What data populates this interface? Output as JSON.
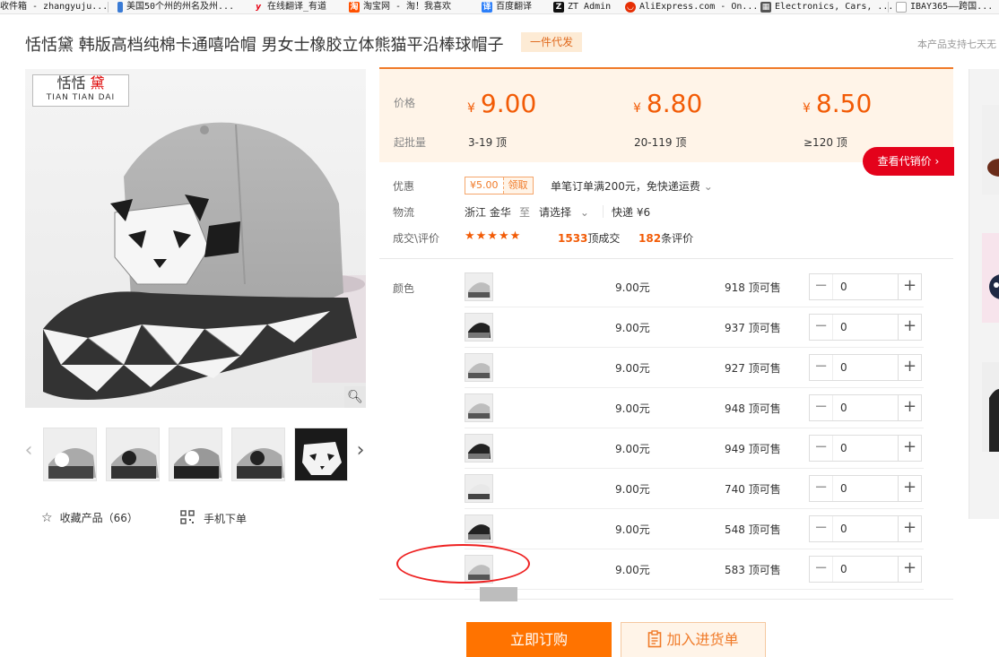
{
  "bookmarks": [
    {
      "label": "收件箱 - zhangyuju...",
      "icon": "mail-icon",
      "color": "#888888"
    },
    {
      "label": "美国50个州的州名及州...",
      "icon": "doc-icon",
      "color": "#3a7bd5"
    },
    {
      "label": "在线翻译_有道",
      "icon": "youdao-icon",
      "color": "#e60012"
    },
    {
      "label": "淘宝网 - 淘！我喜欢",
      "icon": "taobao-icon",
      "color": "#ff5000"
    },
    {
      "label": "百度翻译",
      "icon": "baidu-translate-icon",
      "color": "#2d7ff9"
    },
    {
      "label": "ZT Admin",
      "icon": "zt-icon",
      "color": "#222222"
    },
    {
      "label": "AliExpress.com - On...",
      "icon": "aliexpress-icon",
      "color": "#e62e04"
    },
    {
      "label": "Electronics, Cars, ...",
      "icon": "ebay-icon",
      "color": "#555555"
    },
    {
      "label": "IBAY365——跨国...",
      "icon": "page-icon",
      "color": "#999999"
    }
  ],
  "product": {
    "title": "恬恬黛 韩版高档纯棉卡通嘻哈帽 男女士橡胶立体熊猫平沿棒球帽子",
    "badge": "一件代发",
    "right_note": "本产品支持七天无",
    "logo_cn_1": "恬恬",
    "logo_cn_2": "黛",
    "logo_en": "TIAN TIAN DAI"
  },
  "gallery": {
    "favorite_label": "收藏产品（66）",
    "mobile_label": "手机下单"
  },
  "pricing": {
    "price_label": "价格",
    "moq_label": "起批量",
    "currency": "¥",
    "tiers": [
      {
        "price": "9.00",
        "range": "3-19 顶"
      },
      {
        "price": "8.80",
        "range": "20-119 顶"
      },
      {
        "price": "8.50",
        "range": "≥120 顶"
      }
    ],
    "agent_button": "查看代销价"
  },
  "info": {
    "discount_label": "优惠",
    "coupon_value": "¥5.00",
    "coupon_claim": "领取",
    "discount_text": "单笔订单满200元，免快递运费",
    "shipping_label": "物流",
    "origin": "浙江 金华",
    "to": "至",
    "destination": "请选择",
    "express": "快递 ¥6",
    "review_label": "成交\\评价",
    "stars": "★★★★★",
    "sold_count": "1533",
    "sold_suffix": "顶成交",
    "review_count": "182",
    "review_suffix": "条评价"
  },
  "sku": {
    "color_label": "颜色",
    "rows": [
      {
        "price": "9.00元",
        "stock": "918 顶可售",
        "qty": "0",
        "variant": "gray"
      },
      {
        "price": "9.00元",
        "stock": "937 顶可售",
        "qty": "0",
        "variant": "black"
      },
      {
        "price": "9.00元",
        "stock": "927 顶可售",
        "qty": "0",
        "variant": "gray"
      },
      {
        "price": "9.00元",
        "stock": "948 顶可售",
        "qty": "0",
        "variant": "gray"
      },
      {
        "price": "9.00元",
        "stock": "949 顶可售",
        "qty": "0",
        "variant": "black"
      },
      {
        "price": "9.00元",
        "stock": "740 顶可售",
        "qty": "0",
        "variant": "white"
      },
      {
        "price": "9.00元",
        "stock": "548 顶可售",
        "qty": "0",
        "variant": "black"
      },
      {
        "price": "9.00元",
        "stock": "583 顶可售",
        "qty": "0",
        "variant": "gray"
      }
    ]
  },
  "actions": {
    "order": "立即订购",
    "add_to_cart": "加入进货单"
  },
  "colors": {
    "accent_orange": "#f25b06",
    "button_orange": "#ff7300",
    "agent_red": "#e4021b",
    "annotation_red": "#ee2222"
  }
}
